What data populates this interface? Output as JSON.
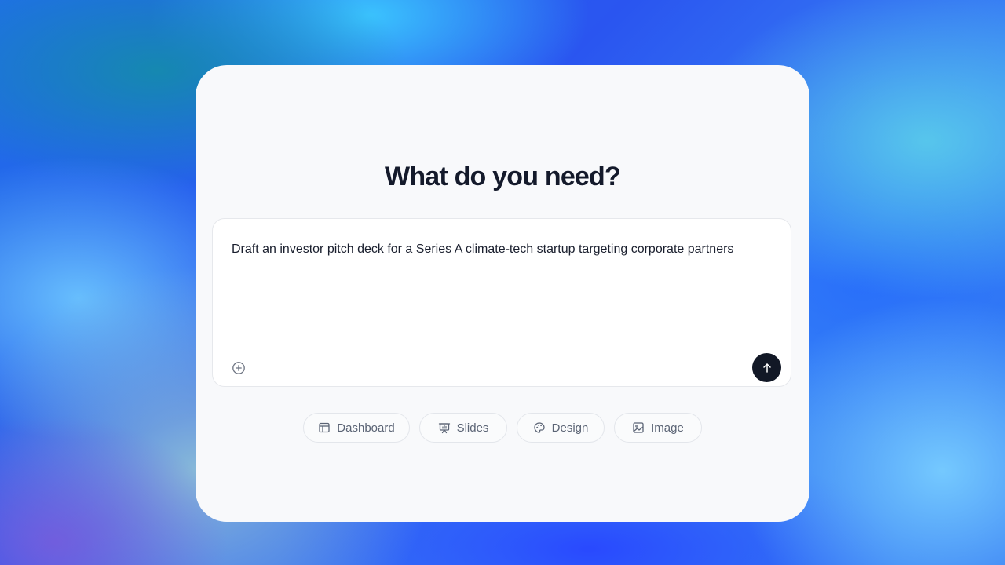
{
  "main": {
    "title": "What do you need?",
    "prompt": {
      "value": "Draft an investor pitch deck for a Series A climate-tech startup targeting corporate partners"
    },
    "chips": [
      {
        "label": "Dashboard",
        "icon": "layout-icon"
      },
      {
        "label": "Slides",
        "icon": "presentation-icon"
      },
      {
        "label": "Design",
        "icon": "palette-icon"
      },
      {
        "label": "Image",
        "icon": "image-icon"
      }
    ]
  },
  "colors": {
    "card_bg": "#f8f9fb",
    "title": "#141a2b",
    "send_button": "#121826",
    "chip_text": "#5b6475"
  }
}
